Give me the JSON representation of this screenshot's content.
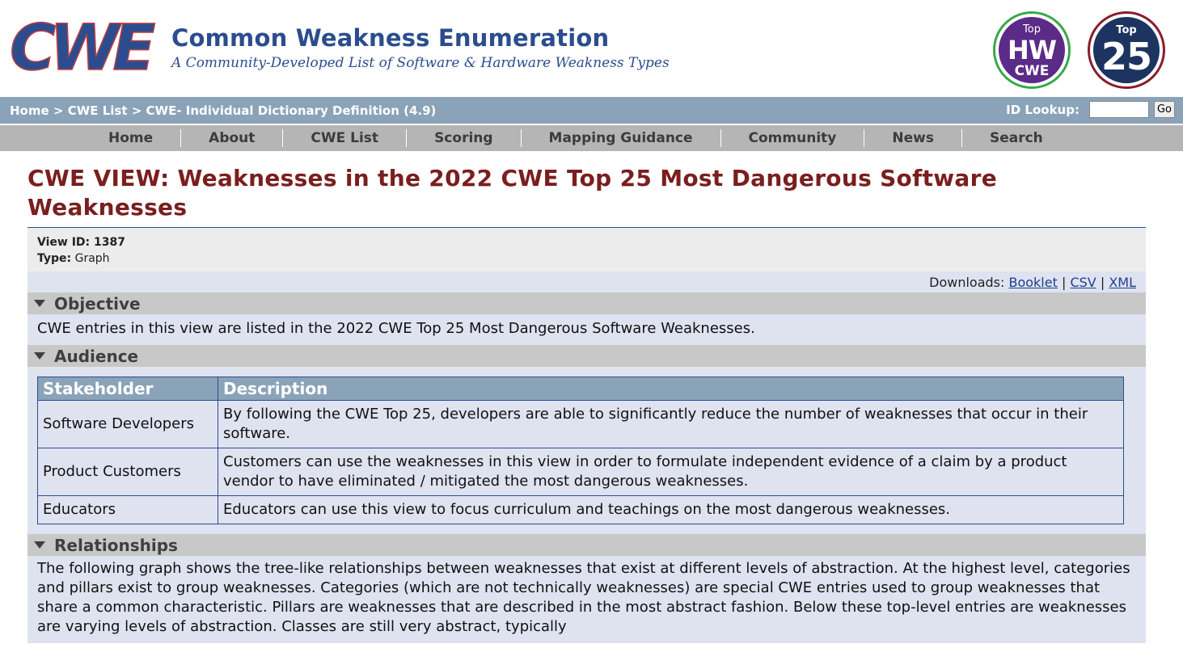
{
  "header": {
    "logo_text": "CWE",
    "title": "Common Weakness Enumeration",
    "subtitle": "A Community-Developed List of Software & Hardware Weakness Types",
    "badge_hw": {
      "top": "Top",
      "middle": "HW",
      "bottom": "CWE"
    },
    "badge_25": {
      "top": "Top",
      "number": "25"
    }
  },
  "breadcrumb": {
    "home": "Home",
    "sep": " > ",
    "cwe_list": "CWE List",
    "current": "CWE- Individual Dictionary Definition (4.9)"
  },
  "lookup": {
    "label": "ID Lookup:",
    "value": "",
    "go_label": "Go"
  },
  "nav": [
    "Home",
    "About",
    "CWE List",
    "Scoring",
    "Mapping Guidance",
    "Community",
    "News",
    "Search"
  ],
  "page": {
    "title": "CWE VIEW: Weaknesses in the 2022 CWE Top 25 Most Dangerous Software Weaknesses",
    "view_id_label": "View ID: 1387",
    "type_label": "Type:",
    "type_value": "Graph",
    "downloads": {
      "label": "Downloads:",
      "booklet": "Booklet",
      "csv": "CSV",
      "xml": "XML",
      "sep": "|"
    }
  },
  "objective": {
    "heading": "Objective",
    "text": "CWE entries in this view are listed in the 2022 CWE Top 25 Most Dangerous Software Weaknesses."
  },
  "audience": {
    "heading": "Audience",
    "columns": [
      "Stakeholder",
      "Description"
    ],
    "rows": [
      [
        "Software Developers",
        "By following the CWE Top 25, developers are able to significantly reduce the number of weaknesses that occur in their software."
      ],
      [
        "Product Customers",
        "Customers can use the weaknesses in this view in order to formulate independent evidence of a claim by a product vendor to have eliminated / mitigated the most dangerous weaknesses."
      ],
      [
        "Educators",
        "Educators can use this view to focus curriculum and teachings on the most dangerous weaknesses."
      ]
    ]
  },
  "relationships": {
    "heading": "Relationships",
    "text": "The following graph shows the tree-like relationships between weaknesses that exist at different levels of abstraction. At the highest level, categories and pillars exist to group weaknesses. Categories (which are not technically weaknesses) are special CWE entries used to group weaknesses that share a common characteristic. Pillars are weaknesses that are described in the most abstract fashion. Below these top-level entries are weaknesses are varying levels of abstraction. Classes are still very abstract, typically"
  },
  "colors": {
    "title_red": "#7a1e1e",
    "brand_blue": "#2b4d8f",
    "bar_steel": "#8aa3b8",
    "nav_gray": "#b5b5b5",
    "section_gray": "#c8c8c8",
    "body_lavender": "#dfe3f0"
  }
}
